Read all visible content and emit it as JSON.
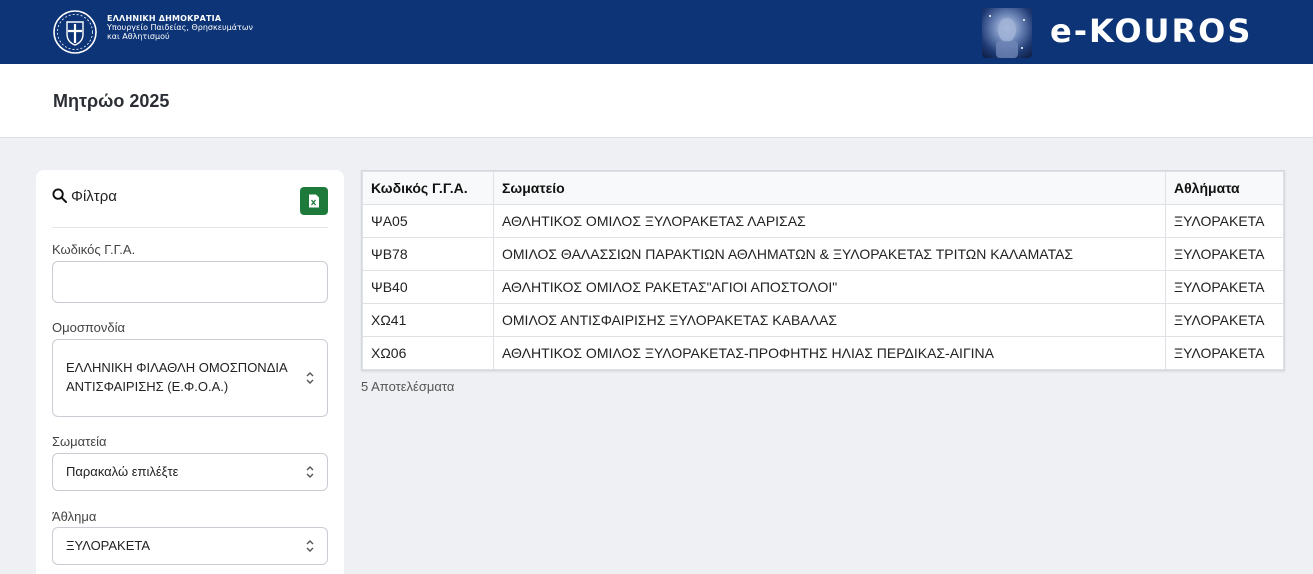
{
  "gov": {
    "line1": "ΕΛΛΗΝΙΚΗ ΔΗΜΟΚΡΑΤΙΑ",
    "line2": "Υπουργείο Παιδείας, Θρησκευμάτων",
    "line3": "και Αθλητισμού",
    "emblem_icon": "greek-coat-of-arms"
  },
  "brand": {
    "name": "e-KOUROS",
    "image_icon": "kouros-statue-image"
  },
  "header": {
    "title": "Μητρώο 2025"
  },
  "filters": {
    "title": "Φίλτρα",
    "search_icon": "search-icon",
    "export_icon": "excel-icon",
    "fields": {
      "code": {
        "label": "Κωδικός Γ.Γ.Α.",
        "value": ""
      },
      "federation": {
        "label": "Ομοσπονδία",
        "value": "ΕΛΛΗΝΙΚΗ ΦΙΛΑΘΛΗ ΟΜΟΣΠΟΝΔΙΑ ΑΝΤΙΣΦΑΙΡΙΣΗΣ (Ε.Φ.Ο.Α.)"
      },
      "club": {
        "label": "Σωματεία",
        "value": "Παρακαλώ επιλέξτε"
      },
      "sport": {
        "label": "Άθλημα",
        "value": "ΞΥΛΟΡΑΚΕΤΑ"
      }
    }
  },
  "table": {
    "headers": [
      "Κωδικός Γ.Γ.Α.",
      "Σωματείο",
      "Αθλήματα"
    ],
    "rows": [
      [
        "ΨΑ05",
        "ΑΘΛΗΤΙΚΟΣ ΟΜΙΛΟΣ ΞΥΛΟΡΑΚΕΤΑΣ ΛΑΡΙΣΑΣ",
        "ΞΥΛΟΡΑΚΕΤΑ"
      ],
      [
        "ΨΒ78",
        "ΟΜΙΛΟΣ ΘΑΛΑΣΣΙΩΝ ΠΑΡΑΚΤΙΩΝ ΑΘΛΗΜΑΤΩΝ & ΞΥΛΟΡΑΚΕΤΑΣ ΤΡΙΤΩΝ ΚΑΛΑΜΑΤΑΣ",
        "ΞΥΛΟΡΑΚΕΤΑ"
      ],
      [
        "ΨΒ40",
        "ΑΘΛΗΤΙΚΟΣ ΟΜΙΛΟΣ ΡΑΚΕΤΑΣ\"ΑΓΙΟΙ ΑΠΟΣΤΟΛΟΙ\"",
        "ΞΥΛΟΡΑΚΕΤΑ"
      ],
      [
        "ΧΩ41",
        "ΟΜΙΛΟΣ ΑΝΤΙΣΦΑΙΡΙΣΗΣ ΞΥΛΟΡΑΚΕΤΑΣ ΚΑΒΑΛΑΣ",
        "ΞΥΛΟΡΑΚΕΤΑ"
      ],
      [
        "ΧΩ06",
        "ΑΘΛΗΤΙΚΟΣ ΟΜΙΛΟΣ ΞΥΛΟΡΑΚΕΤΑΣ-ΠΡΟΦΗΤΗΣ ΗΛΙΑΣ ΠΕΡΔΙΚΑΣ-ΑΙΓΙΝΑ",
        "ΞΥΛΟΡΑΚΕΤΑ"
      ]
    ],
    "results_text": "5 Αποτελέσματα"
  },
  "colors": {
    "topbar": "#0d3476",
    "excel": "#1e7a3a"
  }
}
